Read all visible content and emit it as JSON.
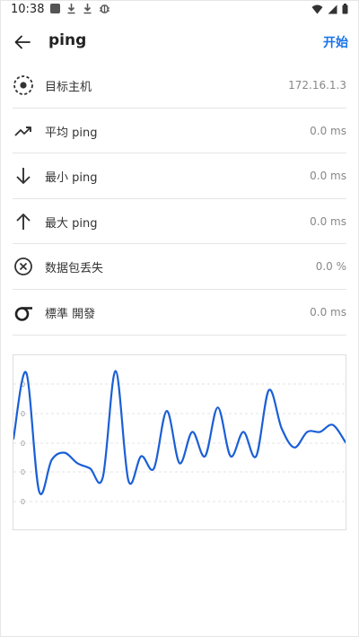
{
  "status": {
    "time": "10:38"
  },
  "header": {
    "title": "ping",
    "start_label": "开始"
  },
  "stats": [
    {
      "label": "目标主机",
      "value": "172.16.1.3",
      "icon": "target-icon"
    },
    {
      "label": "平均 ping",
      "value": "0.0 ms",
      "icon": "trending-up-icon"
    },
    {
      "label": "最小 ping",
      "value": "0.0 ms",
      "icon": "arrow-down-icon"
    },
    {
      "label": "最大 ping",
      "value": "0.0 ms",
      "icon": "arrow-up-icon"
    },
    {
      "label": "数据包丢失",
      "value": "0.0 %",
      "icon": "cancel-circle-icon"
    },
    {
      "label": "標準 開發",
      "value": "0.0 ms",
      "icon": "sigma-icon"
    }
  ],
  "chart_data": {
    "type": "line",
    "y_tick_labels": [
      "0",
      "0",
      "0",
      "0",
      "0"
    ],
    "grid": true,
    "series": [
      {
        "color": "#1a5fd6",
        "values": [
          52,
          90,
          22,
          40,
          44,
          38,
          35,
          30,
          91,
          28,
          42,
          35,
          68,
          38,
          56,
          42,
          70,
          42,
          56,
          42,
          80,
          58,
          47,
          56,
          56,
          60,
          50
        ]
      }
    ]
  },
  "colors": {
    "accent": "#1a73e8",
    "line": "#1a5fd6",
    "divider": "#e5e5e5"
  }
}
